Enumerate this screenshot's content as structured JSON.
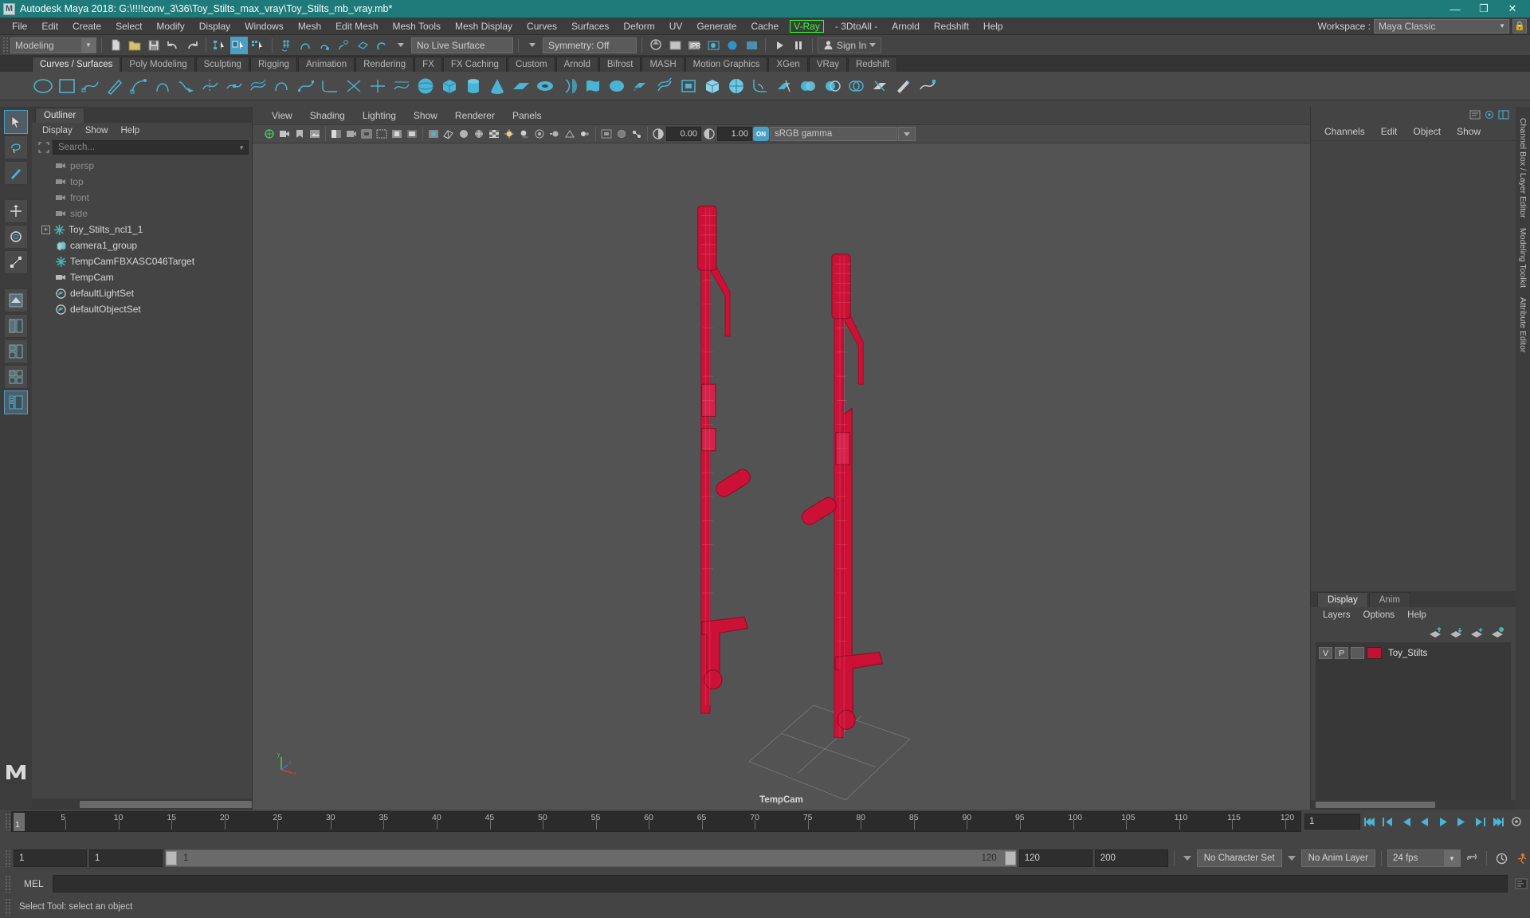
{
  "window": {
    "title": "Autodesk Maya 2018: G:\\!!!!conv_3\\36\\Toy_Stilts_max_vray\\Toy_Stilts_mb_vray.mb*",
    "app_icon": "M",
    "minimize": "—",
    "maximize": "❐",
    "close": "✕"
  },
  "menubar": {
    "items": [
      {
        "label": "File"
      },
      {
        "label": "Edit"
      },
      {
        "label": "Create"
      },
      {
        "label": "Select"
      },
      {
        "label": "Modify"
      },
      {
        "label": "Display"
      },
      {
        "label": "Windows"
      },
      {
        "label": "Mesh"
      },
      {
        "label": "Edit Mesh"
      },
      {
        "label": "Mesh Tools"
      },
      {
        "label": "Mesh Display"
      },
      {
        "label": "Curves"
      },
      {
        "label": "Surfaces"
      },
      {
        "label": "Deform"
      },
      {
        "label": "UV"
      },
      {
        "label": "Generate"
      },
      {
        "label": "Cache"
      },
      {
        "label": "V-Ray",
        "highlight": true
      },
      {
        "label": "- 3DtoAll -"
      },
      {
        "label": "Arnold"
      },
      {
        "label": "Redshift"
      },
      {
        "label": "Help"
      }
    ],
    "vray_color": "#33ff33",
    "workspace_label": "Workspace :",
    "workspace_value": "Maya Classic"
  },
  "statusbar": {
    "mode": "Modeling",
    "live_surface": "No Live Surface",
    "symmetry": "Symmetry: Off",
    "sign_in": "Sign In"
  },
  "shelf": {
    "tabs": [
      {
        "label": "Curves / Surfaces",
        "active": true
      },
      {
        "label": "Poly Modeling",
        "active": false
      },
      {
        "label": "Sculpting",
        "active": false
      },
      {
        "label": "Rigging",
        "active": false
      },
      {
        "label": "Animation",
        "active": false
      },
      {
        "label": "Rendering",
        "active": false
      },
      {
        "label": "FX",
        "active": false
      },
      {
        "label": "FX Caching",
        "active": false
      },
      {
        "label": "Custom",
        "active": false
      },
      {
        "label": "Arnold",
        "active": false
      },
      {
        "label": "Bifrost",
        "active": false
      },
      {
        "label": "MASH",
        "active": false
      },
      {
        "label": "Motion Graphics",
        "active": false
      },
      {
        "label": "XGen",
        "active": false
      },
      {
        "label": "VRay",
        "active": false
      },
      {
        "label": "Redshift",
        "active": false
      }
    ]
  },
  "outliner": {
    "tab": "Outliner",
    "menu": [
      "Display",
      "Show",
      "Help"
    ],
    "search_placeholder": "Search...",
    "items": [
      {
        "label": "persp",
        "icon": "camera-icon",
        "dim": true,
        "indent": 28,
        "expander": false
      },
      {
        "label": "top",
        "icon": "camera-icon",
        "dim": true,
        "indent": 28,
        "expander": false
      },
      {
        "label": "front",
        "icon": "camera-icon",
        "dim": true,
        "indent": 28,
        "expander": false
      },
      {
        "label": "side",
        "icon": "camera-icon",
        "dim": true,
        "indent": 28,
        "expander": false
      },
      {
        "label": "Toy_Stilts_ncl1_1",
        "icon": "transform-icon",
        "dim": false,
        "indent": 28,
        "expander": true
      },
      {
        "label": "camera1_group",
        "icon": "group-icon",
        "dim": false,
        "indent": 28,
        "expander": false
      },
      {
        "label": "TempCamFBXASC046Target",
        "icon": "transform-icon",
        "dim": false,
        "indent": 28,
        "expander": false
      },
      {
        "label": "TempCam",
        "icon": "camera-icon",
        "dim": false,
        "indent": 28,
        "expander": false
      },
      {
        "label": "defaultLightSet",
        "icon": "set-icon",
        "dim": false,
        "indent": 28,
        "expander": false
      },
      {
        "label": "defaultObjectSet",
        "icon": "set-icon",
        "dim": false,
        "indent": 28,
        "expander": false
      }
    ]
  },
  "viewport": {
    "menu": [
      "View",
      "Shading",
      "Lighting",
      "Show",
      "Renderer",
      "Panels"
    ],
    "exposure": "0.00",
    "gamma": "1.00",
    "gamma_toggle": "ON",
    "color_space": "sRGB gamma",
    "camera_label": "TempCam",
    "bg_color": "#535353",
    "model_color": "#cc1136",
    "axis_labels": [
      "y",
      "x",
      "z"
    ]
  },
  "right_panel": {
    "channelbox_menu": [
      "Channels",
      "Edit",
      "Object",
      "Show"
    ],
    "vertical_tabs": [
      "Channel Box / Layer Editor",
      "Modeling Toolkit",
      "Attribute Editor"
    ],
    "layer_tabs": [
      {
        "label": "Display",
        "active": true
      },
      {
        "label": "Anim",
        "active": false
      }
    ],
    "layer_menu": [
      "Layers",
      "Options",
      "Help"
    ],
    "layers": [
      {
        "visible": "V",
        "playback": "P",
        "shading": "",
        "color": "#c41036",
        "name": "Toy_Stilts"
      }
    ]
  },
  "timeline": {
    "current_frame": "1",
    "ticks": [
      5,
      10,
      15,
      20,
      25,
      30,
      35,
      40,
      45,
      50,
      55,
      60,
      65,
      70,
      75,
      80,
      85,
      90,
      95,
      100,
      105,
      110,
      115,
      120
    ],
    "playhead_label": "1",
    "frame_field": "1",
    "transport": [
      "go-to-start",
      "step-back-key",
      "step-back",
      "play-backwards",
      "play-forwards",
      "step-forward",
      "step-forward-key",
      "go-to-end"
    ]
  },
  "range": {
    "start": "1",
    "range_start": "1",
    "slider_min": "1",
    "slider_max": "120",
    "range_end": "120",
    "end": "200",
    "character_set": "No Character Set",
    "anim_layer": "No Anim Layer",
    "fps": "24 fps"
  },
  "command": {
    "lang_label": "MEL",
    "input_value": ""
  },
  "status": {
    "message": "Select Tool: select an object"
  },
  "colors": {
    "title_bg": "#1f7a7a",
    "panel_bg": "#444444",
    "dark_bg": "#2e2e2e",
    "accent": "#4a9fc4",
    "shelf_icon": "#4bb3d4",
    "model_red": "#cc1136"
  }
}
